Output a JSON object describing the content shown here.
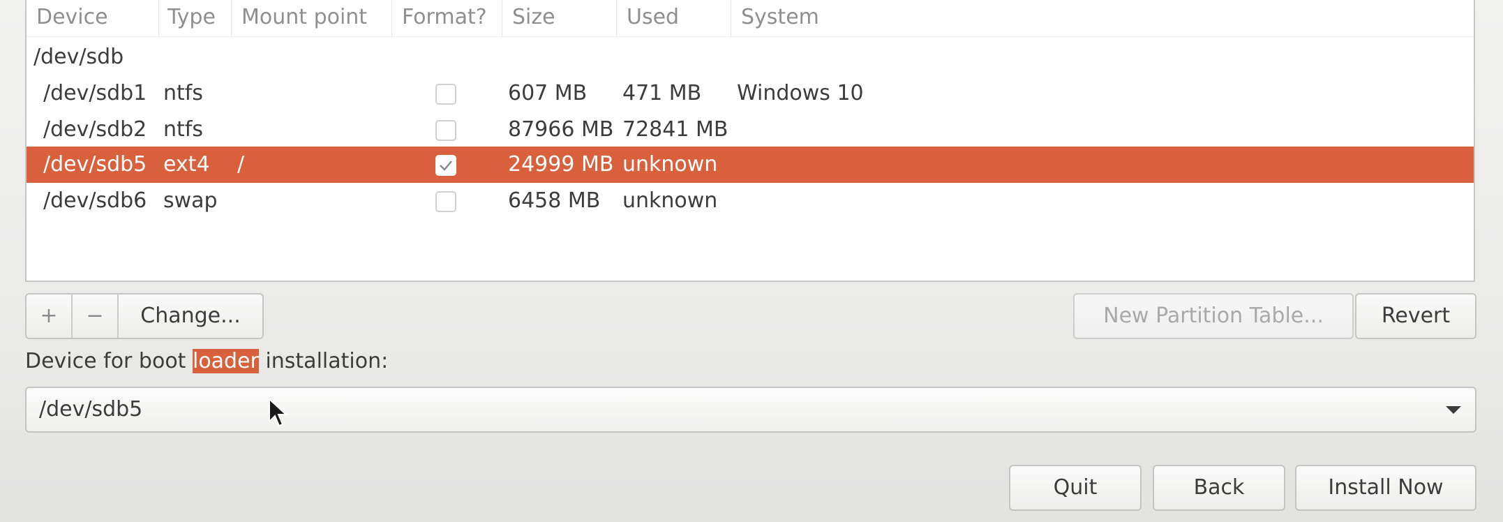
{
  "columns": {
    "device": "Device",
    "type": "Type",
    "mount_point": "Mount point",
    "format": "Format?",
    "size": "Size",
    "used": "Used",
    "system": "System"
  },
  "disk": "/dev/sdb",
  "partitions": [
    {
      "device": "/dev/sdb1",
      "type": "ntfs",
      "mount": "",
      "format": false,
      "size": "607 MB",
      "used": "471 MB",
      "system": "Windows 10"
    },
    {
      "device": "/dev/sdb2",
      "type": "ntfs",
      "mount": "",
      "format": false,
      "size": "87966 MB",
      "used": "72841 MB",
      "system": ""
    },
    {
      "device": "/dev/sdb5",
      "type": "ext4",
      "mount": "/",
      "format": true,
      "size": "24999 MB",
      "used": "unknown",
      "system": "",
      "selected": true
    },
    {
      "device": "/dev/sdb6",
      "type": "swap",
      "mount": "",
      "format": false,
      "size": "6458 MB",
      "used": "unknown",
      "system": ""
    }
  ],
  "toolbar": {
    "add": "+",
    "remove": "−",
    "change": "Change...",
    "new_partition_table": "New Partition Table...",
    "revert": "Revert"
  },
  "bootloader": {
    "label_pre": "Device for boot ",
    "label_highlight": "loader",
    "label_post": " installation:",
    "selected_device": "/dev/sdb5"
  },
  "footer": {
    "quit": "Quit",
    "back": "Back",
    "install_now": "Install Now"
  },
  "colors": {
    "selection": "#d9603c"
  },
  "icons": {
    "checkbox_checked": "check-icon",
    "dropdown": "chevron-down-icon",
    "cursor": "mouse-pointer-icon"
  }
}
